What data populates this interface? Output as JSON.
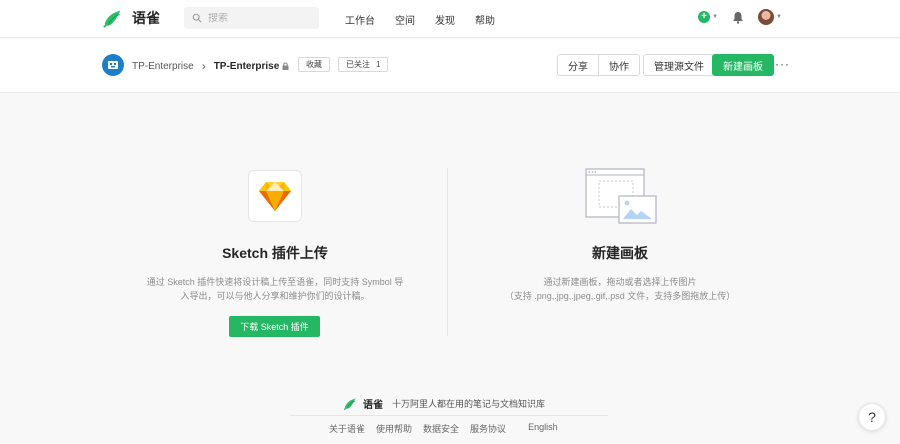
{
  "topnav": {
    "brand": "语雀",
    "search_placeholder": "搜索",
    "links": [
      "工作台",
      "空间",
      "发现",
      "帮助"
    ],
    "plus_icon": "plus-circle-icon",
    "accent": "#25b864"
  },
  "subheader": {
    "parent": "TP-Enterprise",
    "current": "TP-Enterprise",
    "collect_label": "收藏",
    "follow_label": "已关注",
    "follow_count": "1",
    "share_label": "分享",
    "collab_label": "协作",
    "manage_label": "管理源文件",
    "new_board_label": "新建画板",
    "more_label": "···"
  },
  "left_panel": {
    "title": "Sketch 插件上传",
    "desc_line1": "通过 Sketch 插件快速将设计稿上传至语雀，同时支持 Symbol 导",
    "desc_line2": "入导出，可以与他人分享和维护你们的设计稿。",
    "button": "下载 Sketch 插件"
  },
  "right_panel": {
    "title": "新建画板",
    "desc_line1": "通过新建画板，拖动或者选择上传图片",
    "desc_line2": "（支持 .png,.jpg,.jpeg,.gif,.psd 文件，支持多图拖放上传）"
  },
  "footer": {
    "brand": "语雀",
    "slogan": "十万阿里人都在用的笔记与文档知识库",
    "links": [
      "关于语雀",
      "使用帮助",
      "数据安全",
      "服务协议"
    ],
    "language": "English",
    "help": "?"
  }
}
